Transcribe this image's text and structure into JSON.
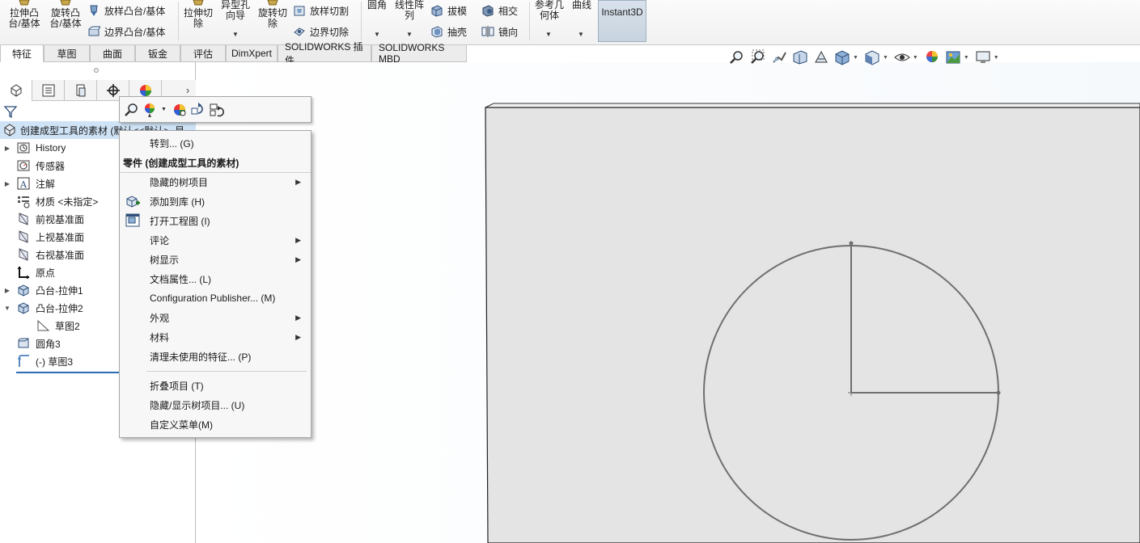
{
  "ribbon": {
    "extrude_boss": "拉伸凸台/基体",
    "revolve_boss": "旋转凸台/基体",
    "sweep_boss": "放样凸台/基体",
    "boundary_boss": "边界凸台/基体",
    "extrude_cut": "拉伸切除",
    "hole_wizard": "异型孔向导",
    "revolve_cut": "旋转切除",
    "loft_cut": "放样切割",
    "boundary_cut": "边界切除",
    "fillet": "圆角",
    "linear_pattern": "线性阵列",
    "draft": "拔模",
    "shell": "抽壳",
    "intersect": "相交",
    "mirror": "镜向",
    "ref_geometry": "参考几何体",
    "curves": "曲线",
    "instant3d": "Instant3D"
  },
  "cm_tabs": [
    "特征",
    "草图",
    "曲面",
    "钣金",
    "评估",
    "DimXpert",
    "SOLIDWORKS 插件",
    "SOLIDWORKS MBD"
  ],
  "tree": {
    "root": "创建成型工具的素材 (默认<<默认>_显",
    "items": [
      {
        "label": "History",
        "exp": "▶"
      },
      {
        "label": "传感器",
        "exp": ""
      },
      {
        "label": "注解",
        "exp": "▶"
      },
      {
        "label": "材质 <未指定>",
        "exp": ""
      },
      {
        "label": "前视基准面",
        "exp": ""
      },
      {
        "label": "上视基准面",
        "exp": ""
      },
      {
        "label": "右视基准面",
        "exp": ""
      },
      {
        "label": "原点",
        "exp": ""
      },
      {
        "label": "凸台-拉伸1",
        "exp": "▶"
      },
      {
        "label": "凸台-拉伸2",
        "exp": "▼"
      },
      {
        "label": "草图2",
        "exp": ""
      },
      {
        "label": "圆角3",
        "exp": ""
      },
      {
        "label": "(-) 草图3",
        "exp": ""
      }
    ]
  },
  "context_menu": {
    "goto": "转到... (G)",
    "header": "零件 (创建成型工具的素材)",
    "hidden_tree_items": "隐藏的树项目",
    "add_to_library": "添加到库 (H)",
    "open_drawing": "打开工程图 (I)",
    "comment": "评论",
    "tree_display": "树显示",
    "document_properties": "文档属性... (L)",
    "configuration_publisher": "Configuration Publisher... (M)",
    "appearance": "外观",
    "material": "材料",
    "purge_unused": "清理未使用的特征... (P)",
    "collapse_items": "折叠项目 (T)",
    "hide_show_tree": "隐藏/显示树项目... (U)",
    "customize_menu": "自定义菜单(M)",
    "submenu_arrow": "▶"
  },
  "colors": {
    "selection": "#cfe3f6",
    "panel_border": "#bdbdbd",
    "model_face": "#e4e4e4",
    "sketch_line": "#6f6f6f"
  }
}
